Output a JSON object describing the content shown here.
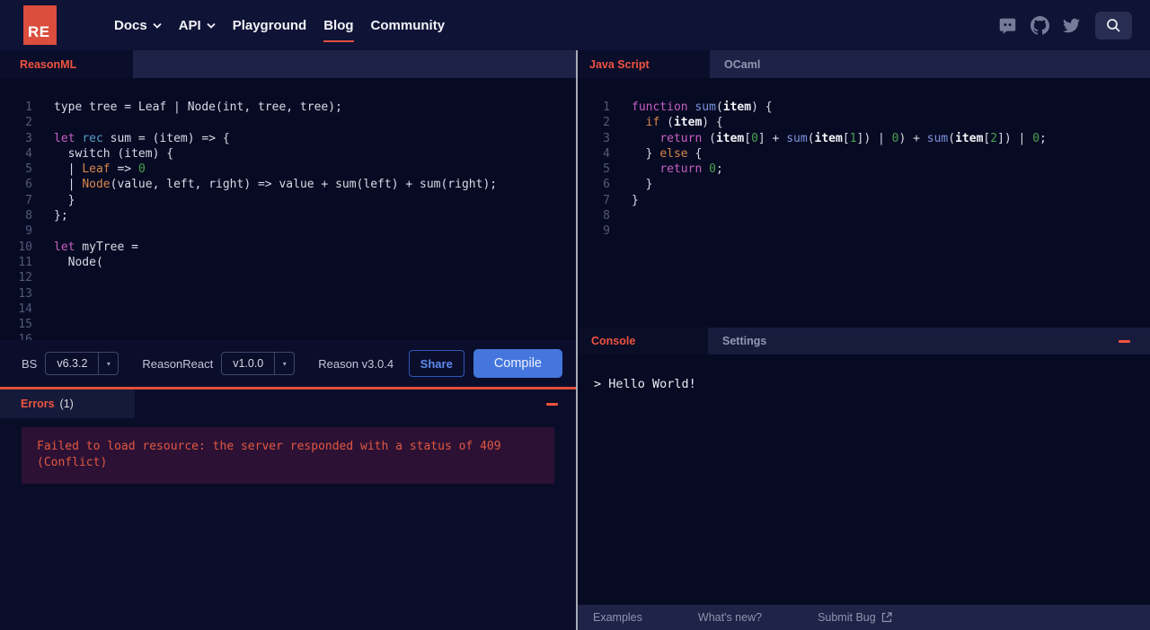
{
  "colors": {
    "accent_red": "#ef5340",
    "logo_red": "#db4d3d",
    "underline_red": "#e0503c",
    "compile_blue": "#4476dd",
    "share_blue": "#5e8aec",
    "error_text": "#e25742",
    "editor_bg": "#070a23"
  },
  "header": {
    "logo_text": "RE",
    "nav": [
      {
        "label": "Docs"
      },
      {
        "label": "API"
      },
      {
        "label": "Playground"
      },
      {
        "label": "Blog"
      },
      {
        "label": "Community"
      }
    ],
    "icons": [
      "discord-icon",
      "github-icon",
      "twitter-icon",
      "search-icon"
    ]
  },
  "left": {
    "tab": "ReasonML",
    "editor_lines": [
      [
        [
          "p",
          "type tree = Leaf | Node(int, tree, tree);"
        ]
      ],
      [],
      [
        [
          "k",
          "let"
        ],
        [
          "p",
          " "
        ],
        [
          "c",
          "rec"
        ],
        [
          "p",
          " sum = (item) => {"
        ]
      ],
      [
        [
          "p",
          "  switch (item) {"
        ]
      ],
      [
        [
          "p",
          "  | "
        ],
        [
          "o",
          "Leaf"
        ],
        [
          "p",
          " => "
        ],
        [
          "g",
          "0"
        ]
      ],
      [
        [
          "p",
          "  | "
        ],
        [
          "o",
          "Node"
        ],
        [
          "p",
          "(value, left, right) => value + sum(left) + sum(right);"
        ]
      ],
      [
        [
          "p",
          "  }"
        ]
      ],
      [
        [
          "p",
          "};"
        ]
      ],
      [],
      [
        [
          "k",
          "let"
        ],
        [
          "p",
          " myTree ="
        ]
      ],
      [
        [
          "p",
          "  Node("
        ]
      ],
      [],
      [],
      [],
      [],
      [],
      [],
      []
    ],
    "toolbar": {
      "bs_label": "BS",
      "bs_version": "v6.3.2",
      "reasonreact_label": "ReasonReact",
      "reasonreact_version": "v1.0.0",
      "reason_version": "Reason v3.0.4",
      "share_label": "Share",
      "compile_label": "Compile"
    },
    "errors": {
      "title": "Errors",
      "count": "(1)",
      "message": "Failed to load resource: the server responded with a status of 409 (Conflict)"
    }
  },
  "right": {
    "tabs": {
      "javascript": "Java Script",
      "ocaml": "OCaml"
    },
    "editor_lines": [
      [
        [
          "k",
          "function"
        ],
        [
          "p",
          " "
        ],
        [
          "b",
          "sum"
        ],
        [
          "p",
          "("
        ],
        [
          "w",
          "item"
        ],
        [
          "p",
          ") {"
        ]
      ],
      [
        [
          "p",
          "  "
        ],
        [
          "o",
          "if"
        ],
        [
          "p",
          " ("
        ],
        [
          "w",
          "item"
        ],
        [
          "p",
          ") {"
        ]
      ],
      [
        [
          "p",
          "    "
        ],
        [
          "k",
          "return"
        ],
        [
          "p",
          " ("
        ],
        [
          "w",
          "item"
        ],
        [
          "p",
          "["
        ],
        [
          "g",
          "0"
        ],
        [
          "p",
          "] + "
        ],
        [
          "b",
          "sum"
        ],
        [
          "p",
          "("
        ],
        [
          "w",
          "item"
        ],
        [
          "p",
          "["
        ],
        [
          "g",
          "1"
        ],
        [
          "p",
          "]) | "
        ],
        [
          "g",
          "0"
        ],
        [
          "p",
          ") + "
        ],
        [
          "b",
          "sum"
        ],
        [
          "p",
          "("
        ],
        [
          "w",
          "item"
        ],
        [
          "p",
          "["
        ],
        [
          "g",
          "2"
        ],
        [
          "p",
          "]) | "
        ],
        [
          "g",
          "0"
        ],
        [
          "p",
          ";"
        ]
      ],
      [
        [
          "p",
          "  } "
        ],
        [
          "o",
          "else"
        ],
        [
          "p",
          " {"
        ]
      ],
      [
        [
          "p",
          "    "
        ],
        [
          "k",
          "return"
        ],
        [
          "p",
          " "
        ],
        [
          "g",
          "0"
        ],
        [
          "p",
          ";"
        ]
      ],
      [
        [
          "p",
          "  }"
        ]
      ],
      [
        [
          "p",
          "}"
        ]
      ],
      [],
      []
    ],
    "console": {
      "tab_console": "Console",
      "tab_settings": "Settings",
      "output": "> Hello World!"
    },
    "footer": {
      "examples": "Examples",
      "whats_new": "What's new?",
      "submit_bug": "Submit Bug"
    }
  }
}
